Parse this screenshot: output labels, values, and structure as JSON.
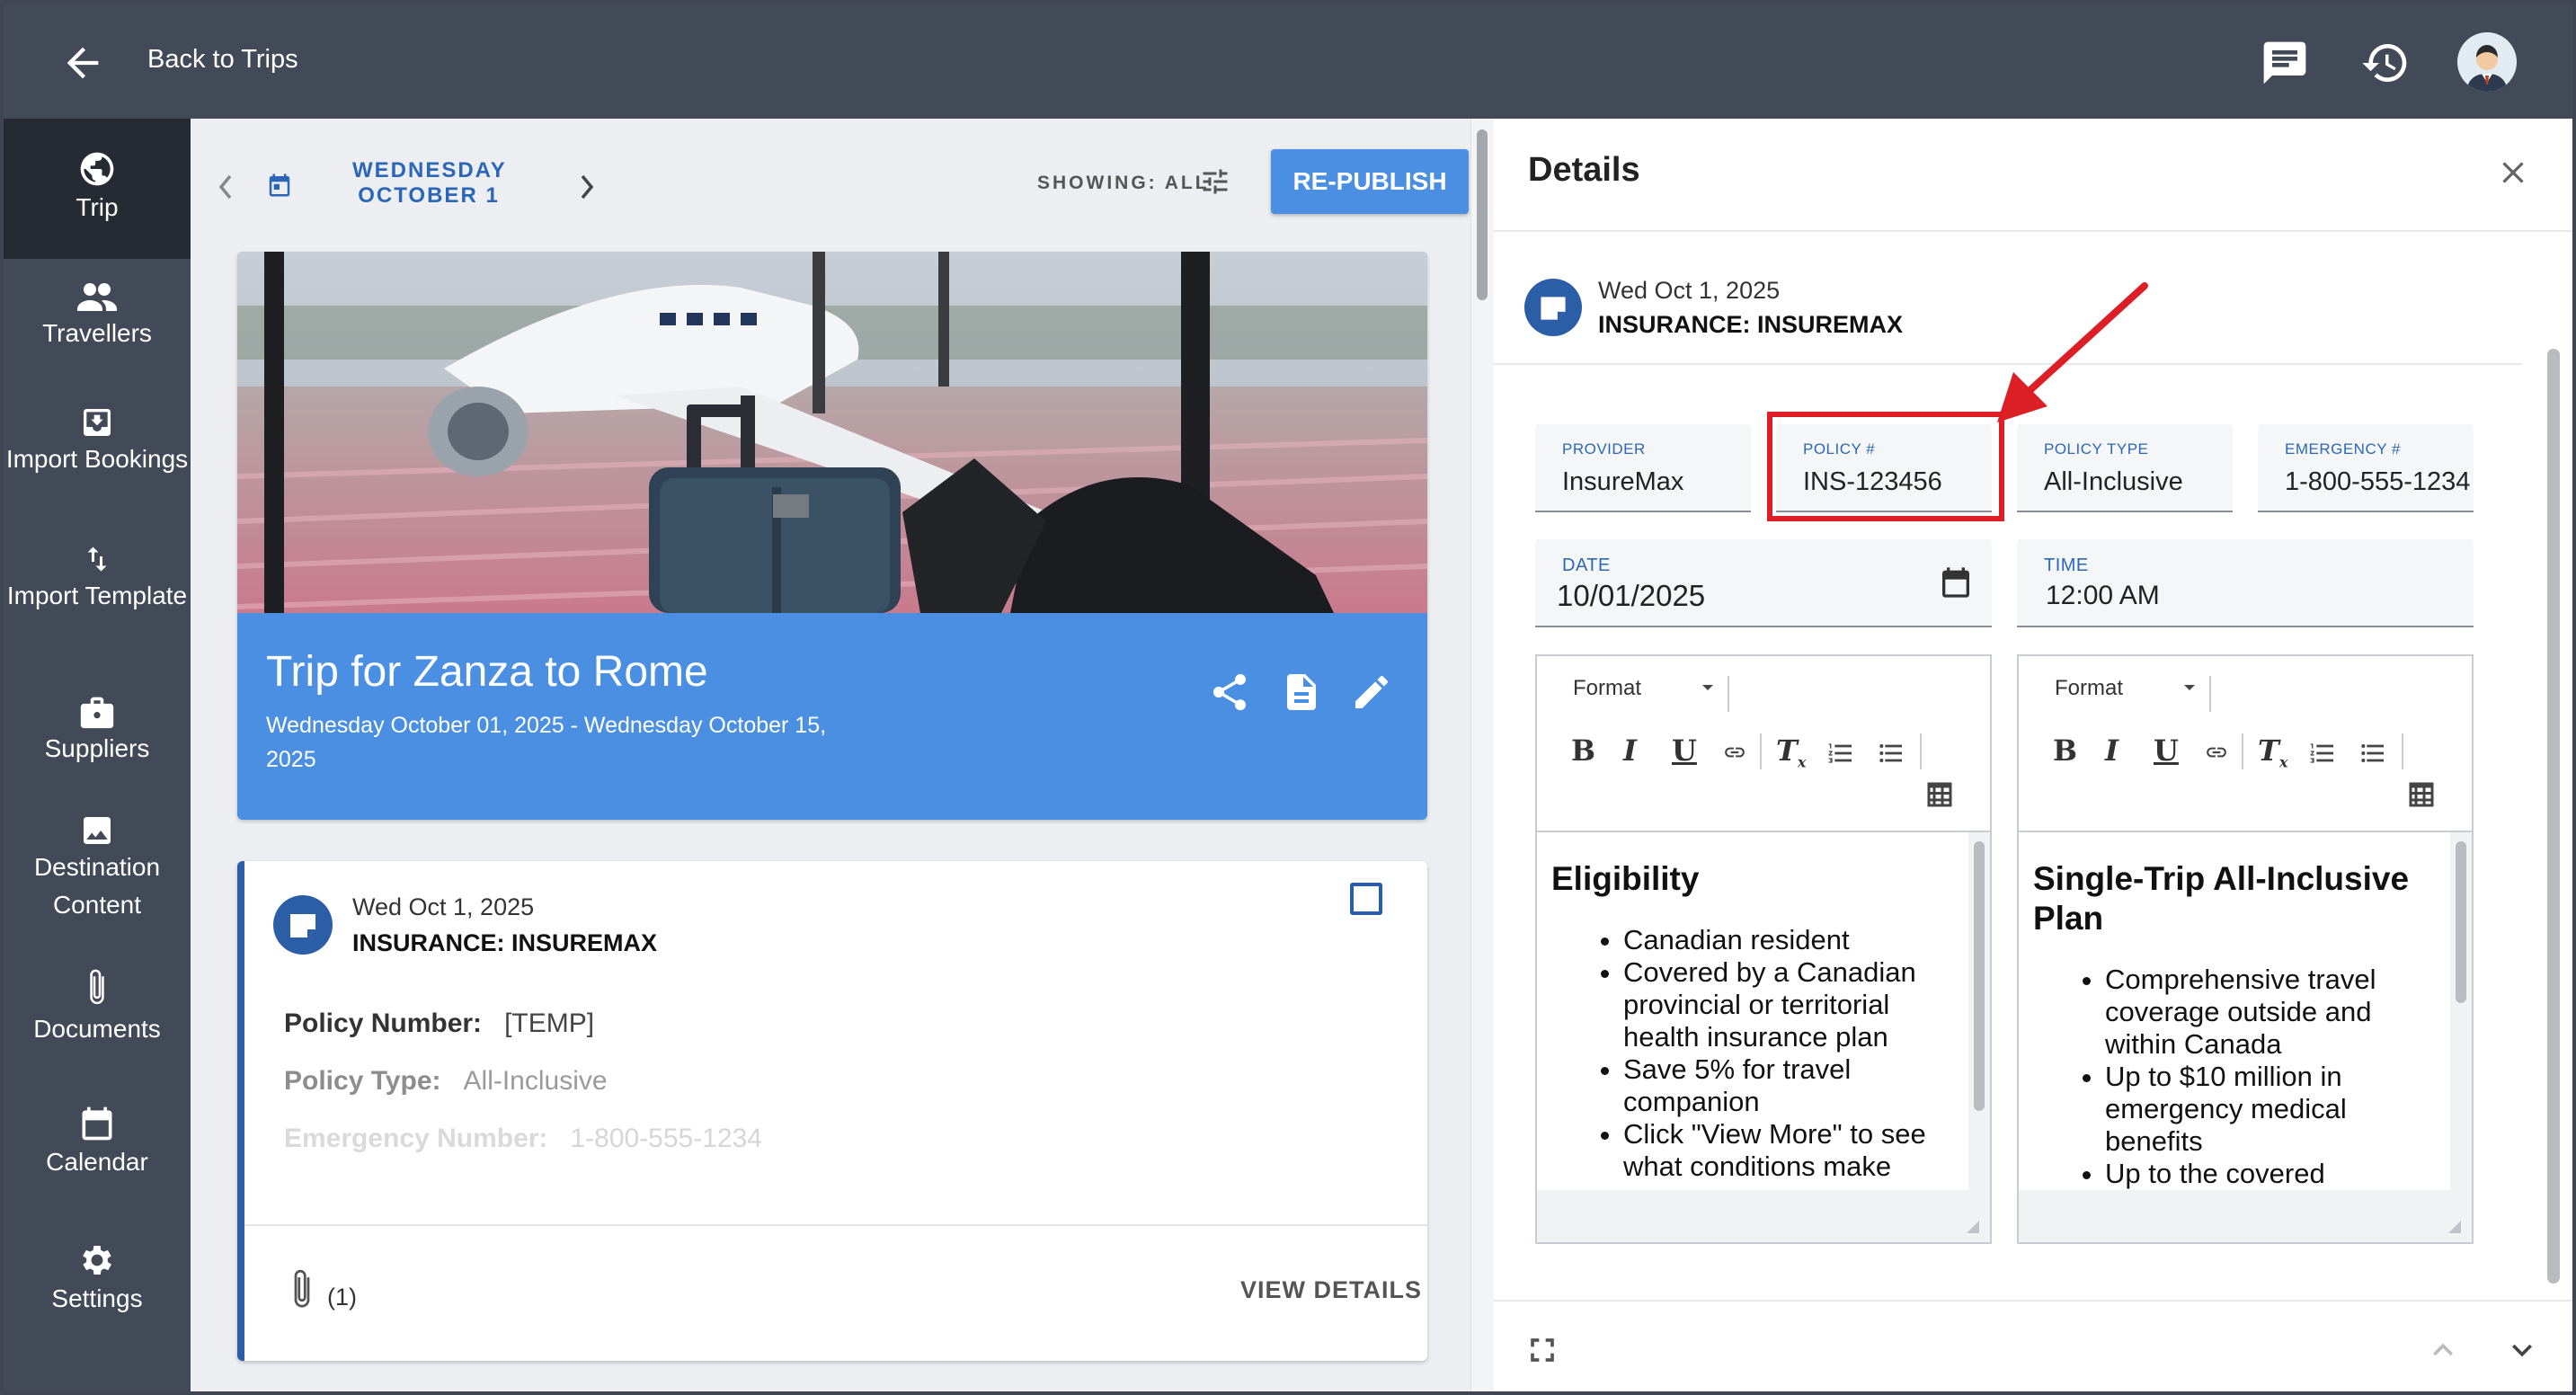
{
  "topbar": {
    "back_label": "Back to Trips"
  },
  "sidebar": {
    "items": [
      {
        "label": "Trip",
        "icon": "globe-icon"
      },
      {
        "label": "Travellers",
        "icon": "people-icon"
      },
      {
        "label": "Import Bookings",
        "icon": "import-icon"
      },
      {
        "label": "Import Template",
        "icon": "sort-arrows-icon"
      },
      {
        "label": "Suppliers",
        "icon": "briefcase-icon"
      },
      {
        "label": "Destination Content",
        "icon": "image-icon"
      },
      {
        "label": "Documents",
        "icon": "paperclip-icon"
      },
      {
        "label": "Calendar",
        "icon": "calendar-icon"
      },
      {
        "label": "Settings",
        "icon": "gear-icon"
      }
    ]
  },
  "day": {
    "weekday": "WEDNESDAY",
    "date": "OCTOBER 1",
    "showing": "SHOWING: ALL",
    "republish": "RE-PUBLISH"
  },
  "trip": {
    "title": "Trip for Zanza to Rome",
    "dates": "Wednesday October 01, 2025 - Wednesday October 15, 2025"
  },
  "insurance_card": {
    "date": "Wed Oct 1, 2025",
    "heading": "INSURANCE: INSUREMAX",
    "policy_number_label": "Policy Number:",
    "policy_number_value": "[TEMP]",
    "policy_type_label": "Policy Type:",
    "policy_type_value": "All-Inclusive",
    "emergency_label": "Emergency Number:",
    "emergency_value": "1-800-555-1234",
    "attachments": "(1)",
    "view_details": "VIEW DETAILS"
  },
  "details": {
    "title": "Details",
    "date": "Wed Oct 1, 2025",
    "heading": "INSURANCE: INSUREMAX",
    "fields": {
      "provider": {
        "label": "PROVIDER",
        "value": "InsureMax"
      },
      "policy": {
        "label": "POLICY #",
        "value": "INS-123456"
      },
      "policy_type": {
        "label": "POLICY TYPE",
        "value": "All-Inclusive"
      },
      "emergency": {
        "label": "EMERGENCY #",
        "value": "1-800-555-1234"
      },
      "date": {
        "label": "DATE",
        "value": "10/01/2025"
      },
      "time": {
        "label": "TIME",
        "value": "12:00 AM"
      }
    },
    "editor_left": {
      "format": "Format",
      "heading": "Eligibility",
      "bullets": [
        "Canadian resident",
        "Covered by a Canadian provincial or territorial health insurance plan",
        "Save 5% for travel companion",
        "Click \"View More\" to see what conditions make"
      ]
    },
    "editor_right": {
      "format": "Format",
      "heading": "Single-Trip All-Inclusive Plan",
      "bullets": [
        "Comprehensive travel coverage outside and within Canada",
        "Up to $10 million in emergency medical benefits",
        "Up to the covered"
      ]
    }
  },
  "colors": {
    "accent": "#4a8fe2",
    "sidebar": "#424957",
    "highlight": "#dc1f24"
  }
}
